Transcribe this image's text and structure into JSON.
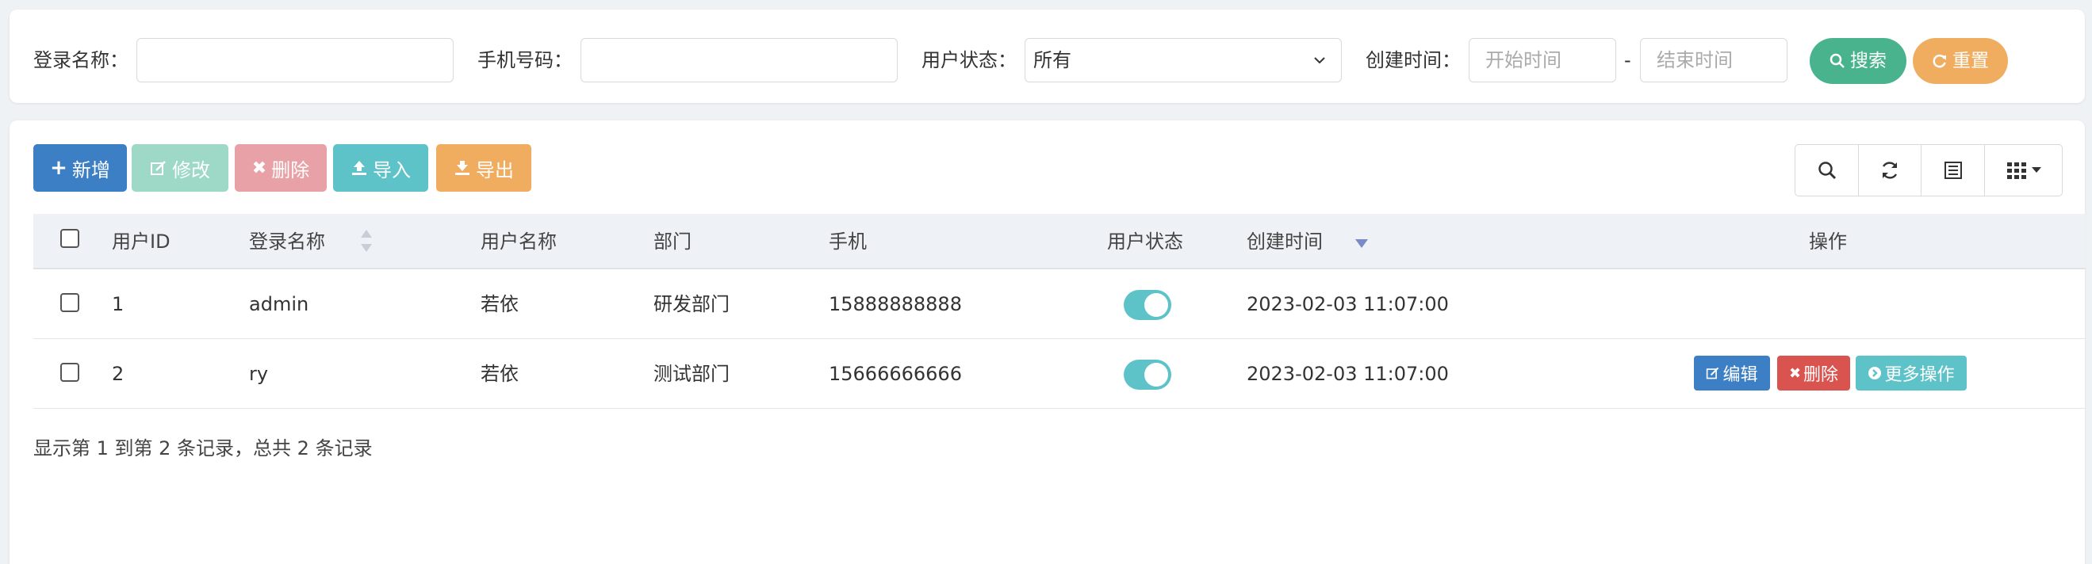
{
  "search": {
    "login_name_label": "登录名称：",
    "login_name_value": "",
    "phone_label": "手机号码：",
    "phone_value": "",
    "status_label": "用户状态：",
    "status_selected": "所有",
    "created_label": "创建时间：",
    "start_placeholder": "开始时间",
    "dash": "-",
    "end_placeholder": "结束时间",
    "search_button": "搜索",
    "reset_button": "重置"
  },
  "toolbar": {
    "add": "新增",
    "edit": "修改",
    "delete": "删除",
    "import": "导入",
    "export": "导出"
  },
  "table": {
    "headers": {
      "user_id": "用户ID",
      "login_name": "登录名称",
      "user_name": "用户名称",
      "dept": "部门",
      "phone": "手机",
      "status": "用户状态",
      "created": "创建时间",
      "actions": "操作"
    },
    "rows": [
      {
        "id": "1",
        "login_name": "admin",
        "user_name": "若依",
        "dept": "研发部门",
        "phone": "15888888888",
        "status_enabled": true,
        "created": "2023-02-03 11:07:00",
        "actions": []
      },
      {
        "id": "2",
        "login_name": "ry",
        "user_name": "若依",
        "dept": "测试部门",
        "phone": "15666666666",
        "status_enabled": true,
        "created": "2023-02-03 11:07:00",
        "actions": [
          "编辑",
          "删除",
          "更多操作"
        ]
      }
    ]
  },
  "footer": {
    "summary": "显示第 1 到第 2 条记录，总共 2 条记录"
  },
  "colors": {
    "primary": "#3c7fc5",
    "success": "#48b38d",
    "warning": "#f0ad60",
    "danger": "#d9534f",
    "info": "#5ec3c8"
  }
}
